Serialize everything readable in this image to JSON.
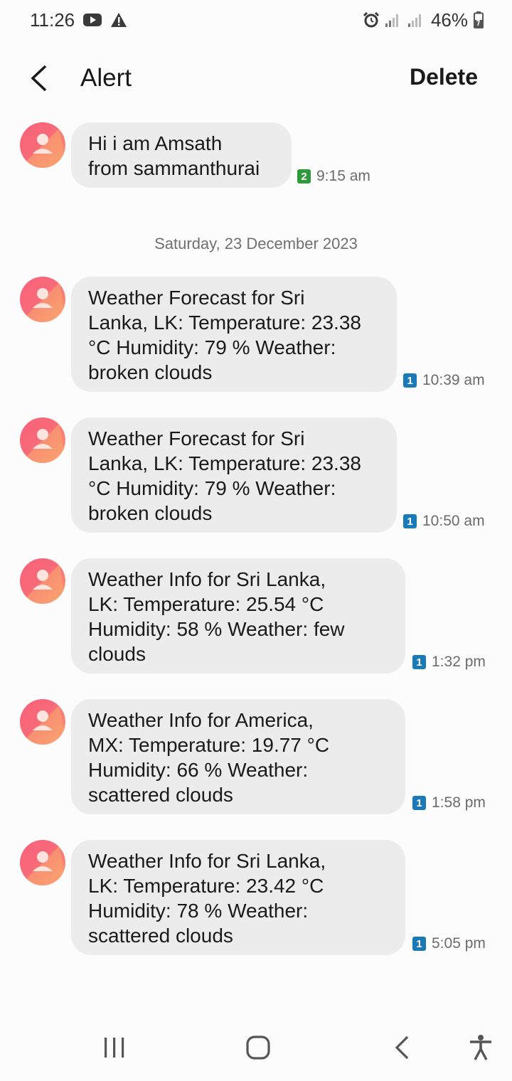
{
  "status_bar": {
    "time": "11:26",
    "battery": "46%",
    "icons": [
      "youtube-icon",
      "warning-icon",
      "alarm-icon",
      "signal-icon",
      "signal-icon",
      "battery-icon"
    ]
  },
  "header": {
    "title": "Alert",
    "delete_label": "Delete"
  },
  "conversation": {
    "date_separator": "Saturday, 23 December 2023",
    "messages": [
      {
        "text_lines": [
          "Hi i am Amsath",
          "from sammanthurai"
        ],
        "sim": "2",
        "time": "9:15 am"
      },
      {
        "text_lines": [
          "Weather Forecast for Sri",
          "Lanka, LK: Temperature: 23.38",
          "°C Humidity: 79 % Weather:",
          "broken clouds"
        ],
        "sim": "1",
        "time": "10:39 am"
      },
      {
        "text_lines": [
          "Weather Forecast for Sri",
          "Lanka, LK: Temperature: 23.38",
          "°C Humidity: 79 % Weather:",
          "broken clouds"
        ],
        "sim": "1",
        "time": "10:50 am"
      },
      {
        "text_lines": [
          "Weather Info for Sri Lanka,",
          "LK: Temperature: 25.54 °C",
          "Humidity: 58 % Weather: few",
          "clouds"
        ],
        "sim": "1",
        "time": "1:32 pm"
      },
      {
        "text_lines": [
          "Weather Info for America,",
          "MX: Temperature: 19.77 °C",
          "Humidity: 66 % Weather:",
          "scattered clouds"
        ],
        "sim": "1",
        "time": "1:58 pm"
      },
      {
        "text_lines": [
          "Weather Info for Sri Lanka,",
          "LK: Temperature: 23.42 °C",
          "Humidity: 78 % Weather:",
          "scattered clouds"
        ],
        "sim": "1",
        "time": "5:05 pm"
      }
    ]
  },
  "colors": {
    "sim1": "#1a7ab8",
    "sim2": "#2e9a3c",
    "bubble": "#ececec",
    "avatar_start": "#f85f7a",
    "avatar_end": "#f9a070"
  },
  "nav_bar": {
    "icons": [
      "recents-icon",
      "home-icon",
      "back-icon",
      "accessibility-icon"
    ]
  }
}
